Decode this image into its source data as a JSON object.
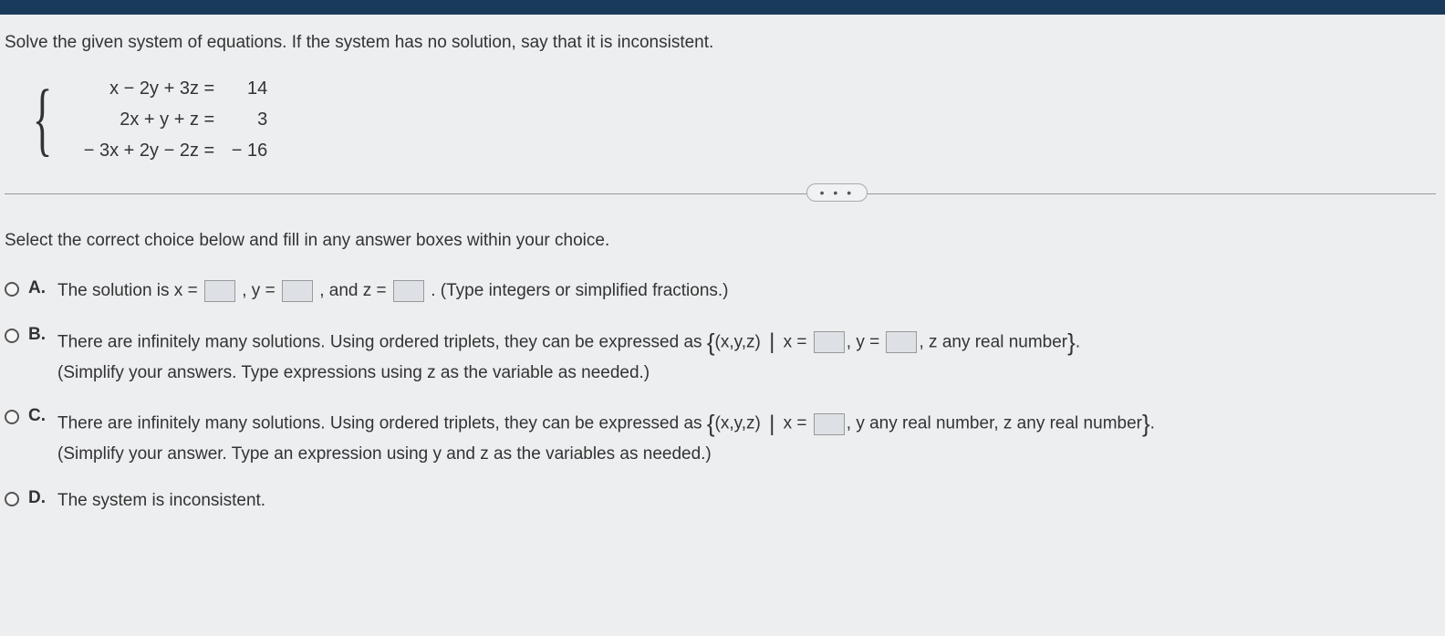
{
  "question": "Solve the given system of equations. If the system has no solution, say that it is inconsistent.",
  "equations": [
    {
      "lhs": "x − 2y + 3z =",
      "rhs": "14"
    },
    {
      "lhs": "2x +   y +   z =",
      "rhs": "3"
    },
    {
      "lhs": "− 3x + 2y − 2z =",
      "rhs": "− 16"
    }
  ],
  "instruction": "Select the correct choice below and fill in any answer boxes within your choice.",
  "ellipsis": "• • •",
  "choices": {
    "a": {
      "label": "A.",
      "pre": "The solution is x =",
      "mid1": ", y =",
      "mid2": ", and z =",
      "post": ". (Type integers or simplified fractions.)"
    },
    "b": {
      "label": "B.",
      "line1_pre": "There are infinitely many solutions. Using ordered triplets, they can be expressed as ",
      "set_open": "{",
      "tuple": "(x,y,z)",
      "bar": "|",
      "x_eq": " x =",
      "y_eq": ", y =",
      "tail": ", z any real number",
      "set_close": "}",
      "period": ".",
      "line2": "(Simplify your answers. Type expressions using z as the variable as needed.)"
    },
    "c": {
      "label": "C.",
      "line1_pre": "There are infinitely many solutions. Using ordered triplets, they can be expressed as ",
      "set_open": "{",
      "tuple": "(x,y,z)",
      "bar": "|",
      "x_eq": " x =",
      "tail": ", y any real number, z any real number",
      "set_close": "}",
      "period": ".",
      "line2": "(Simplify your answer. Type an expression using y and z as the variables as needed.)"
    },
    "d": {
      "label": "D.",
      "text": "The system is inconsistent."
    }
  }
}
